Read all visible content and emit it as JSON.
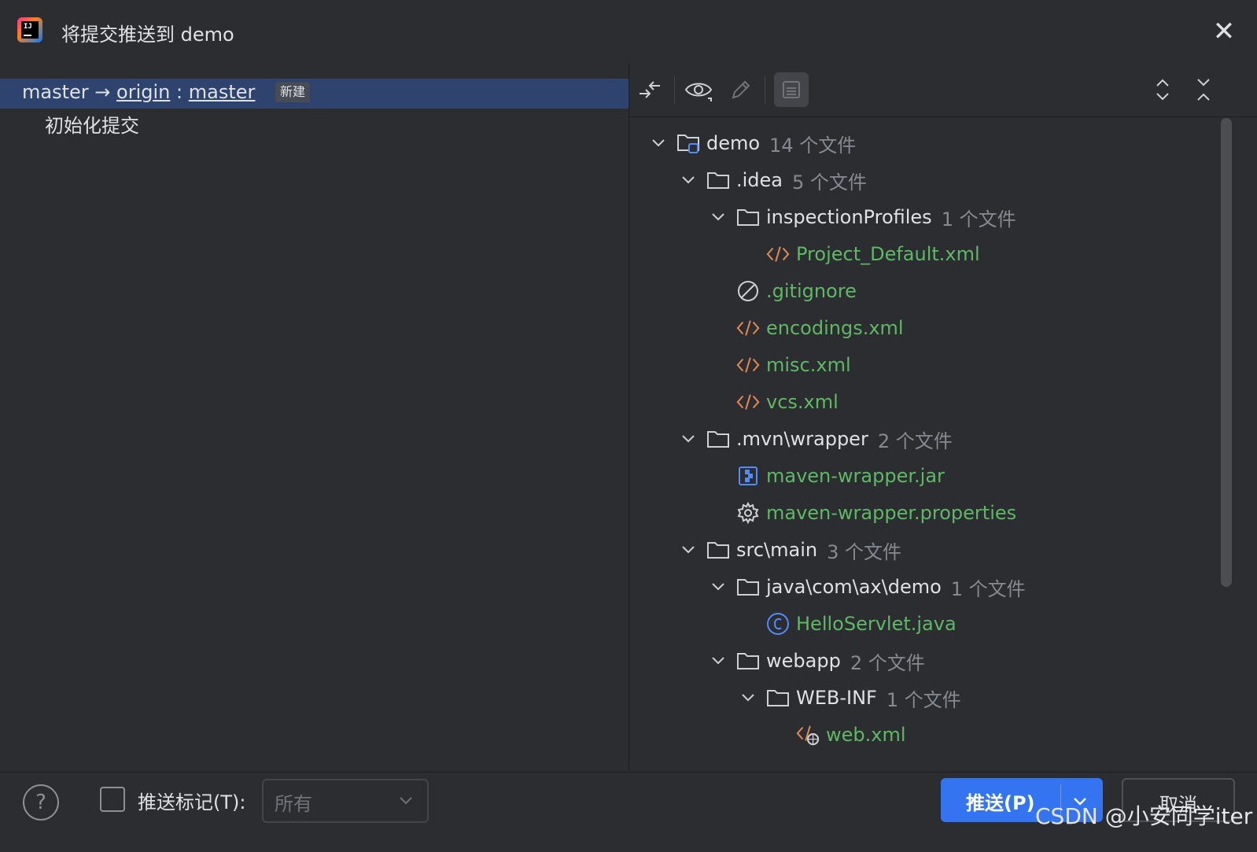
{
  "window": {
    "title": "将提交推送到 demo",
    "close_icon": "close-icon"
  },
  "commits": {
    "branch": {
      "local": "master",
      "arrow": "→",
      "remote": "origin",
      "separator": ":",
      "remote_branch": "master",
      "badge": "新建"
    },
    "items": [
      "初始化提交"
    ]
  },
  "toolbar": {
    "buttons": [
      "collapse-to-arrow-icon",
      "eye-icon",
      "pencil-icon",
      "panel-icon",
      "expand-all-icon",
      "collapse-all-icon"
    ]
  },
  "tree": [
    {
      "name": "demo",
      "count": "14 个文件",
      "icon": "module-folder-icon",
      "expanded": true
    },
    {
      "name": ".idea",
      "count": "5 个文件",
      "icon": "folder-icon",
      "expanded": true
    },
    {
      "name": "inspectionProfiles",
      "count": "1 个文件",
      "icon": "folder-icon",
      "expanded": true
    },
    {
      "name": "Project_Default.xml",
      "count": "",
      "icon": "xml-icon"
    },
    {
      "name": ".gitignore",
      "count": "",
      "icon": "ignore-icon"
    },
    {
      "name": "encodings.xml",
      "count": "",
      "icon": "xml-icon"
    },
    {
      "name": "misc.xml",
      "count": "",
      "icon": "xml-icon"
    },
    {
      "name": "vcs.xml",
      "count": "",
      "icon": "xml-icon"
    },
    {
      "name": ".mvn\\wrapper",
      "count": "2 个文件",
      "icon": "folder-icon",
      "expanded": true
    },
    {
      "name": "maven-wrapper.jar",
      "count": "",
      "icon": "jar-icon"
    },
    {
      "name": "maven-wrapper.properties",
      "count": "",
      "icon": "gear-icon"
    },
    {
      "name": "src\\main",
      "count": "3 个文件",
      "icon": "folder-icon",
      "expanded": true
    },
    {
      "name": "java\\com\\ax\\demo",
      "count": "1 个文件",
      "icon": "folder-icon",
      "expanded": true
    },
    {
      "name": "HelloServlet.java",
      "count": "",
      "icon": "java-class-icon"
    },
    {
      "name": "webapp",
      "count": "2 个文件",
      "icon": "folder-icon",
      "expanded": true
    },
    {
      "name": "WEB-INF",
      "count": "1 个文件",
      "icon": "folder-icon",
      "expanded": true
    },
    {
      "name": "web.xml",
      "count": "",
      "icon": "web-xml-icon"
    }
  ],
  "footer": {
    "help": "?",
    "push_tags_label": "推送标记(T):",
    "push_tags_checked": false,
    "tags_select_value": "所有",
    "push_label": "推送(P)",
    "cancel_label": "取消",
    "watermark": "CSDN @小安同学iter"
  },
  "colors": {
    "accent": "#3574f0",
    "modified_file": "#5fb865",
    "selection": "#2e436e"
  }
}
